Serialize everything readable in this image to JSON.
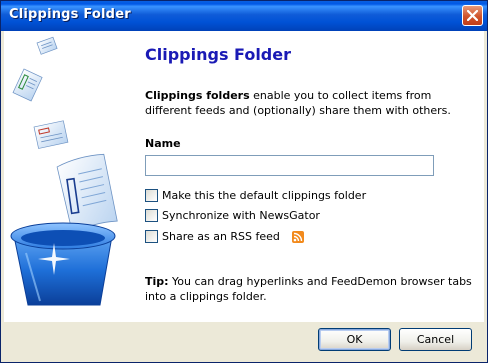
{
  "window": {
    "title": "Clippings Folder"
  },
  "main": {
    "heading": "Clippings Folder",
    "description_bold": "Clippings folders",
    "description_rest": " enable you to collect items from different feeds and (optionally) share them with others.",
    "name_label": "Name",
    "name_value": "",
    "options": [
      {
        "label": "Make this the default clippings folder",
        "checked": false
      },
      {
        "label": "Synchronize with NewsGator",
        "checked": false
      },
      {
        "label": "Share as an RSS feed",
        "checked": false
      }
    ],
    "tip_bold": "Tip:",
    "tip_rest": " You can drag hyperlinks and FeedDemon browser tabs into a clippings folder."
  },
  "buttons": {
    "ok": "OK",
    "cancel": "Cancel"
  },
  "colors": {
    "heading": "#1a1ab5",
    "titlebar": "#0058e6",
    "rss": "#f28a1c",
    "basket": "#1e6fd8"
  },
  "icons": {
    "close": "close-icon",
    "rss": "rss-feed-icon",
    "art": "clippings-basket-illustration"
  }
}
